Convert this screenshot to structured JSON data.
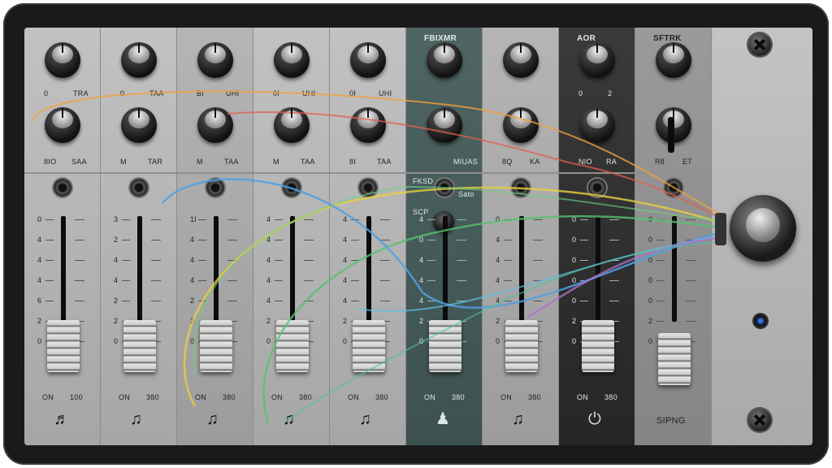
{
  "mixer": {
    "channels": [
      {
        "header": "",
        "knob1_left": "0",
        "knob1_right": "TRA",
        "knob2_left": "8IO",
        "knob2_right": "SAA",
        "scale": [
          "0",
          "4",
          "4",
          "4",
          "6",
          "2",
          "0"
        ],
        "foot_left": "ON",
        "foot_right": "100",
        "icon": "music-note-icon",
        "glyph": "♬",
        "style": "plain"
      },
      {
        "header": "",
        "knob1_left": "0",
        "knob1_right": "TAA",
        "knob2_left": "M",
        "knob2_right": "TAR",
        "scale": [
          "3",
          "2",
          "4",
          "4",
          "2",
          "2",
          "0"
        ],
        "foot_left": "ON",
        "foot_right": "380",
        "icon": "music-note-icon",
        "glyph": "♫",
        "style": "plain"
      },
      {
        "header": "",
        "knob1_left": "BI",
        "knob1_right": "UHI",
        "knob2_left": "M",
        "knob2_right": "TAA",
        "scale": [
          "1I",
          "4",
          "4",
          "4",
          "2",
          "3",
          "0"
        ],
        "foot_left": "ON",
        "foot_right": "380",
        "icon": "music-note-icon",
        "glyph": "♫",
        "style": "alt"
      },
      {
        "header": "",
        "knob1_left": "0I",
        "knob1_right": "UHI",
        "knob2_left": "M",
        "knob2_right": "TAA",
        "scale": [
          "4",
          "4",
          "4",
          "4",
          "4",
          "2",
          "0"
        ],
        "foot_left": "ON",
        "foot_right": "380",
        "icon": "music-note-icon",
        "glyph": "♫",
        "style": "plain"
      },
      {
        "header": "",
        "knob1_left": "0I",
        "knob1_right": "UHI",
        "knob2_left": "8I",
        "knob2_right": "TAA",
        "scale": [
          "4",
          "4",
          "4",
          "4",
          "4",
          "2",
          "0"
        ],
        "foot_left": "ON",
        "foot_right": "380",
        "icon": "music-note-icon",
        "glyph": "♫",
        "style": "plain"
      },
      {
        "header": "FBIXMR",
        "knob1_left": "",
        "knob1_right": "",
        "knob2_left": "",
        "knob2_right": "MIUAS",
        "section": "FKSD",
        "section2": "SCP",
        "section3": "Sato",
        "scale": [
          "4",
          "0",
          "4",
          "4",
          "4",
          "2",
          "0"
        ],
        "foot_left": "ON",
        "foot_right": "380",
        "icon": "robot-icon",
        "glyph": "♟",
        "style": "teal"
      },
      {
        "header": "",
        "knob1_left": "",
        "knob1_right": "",
        "knob2_left": "8Q",
        "knob2_right": "KA",
        "scale": [
          "0",
          "4",
          "4",
          "4",
          "4",
          "2",
          "0"
        ],
        "foot_left": "ON",
        "foot_right": "380",
        "icon": "music-note-icon",
        "glyph": "♫",
        "style": "alt"
      },
      {
        "header": "AOR",
        "knob1_left": "0",
        "knob1_right": "2",
        "knob2_left": "NIO",
        "knob2_right": "RA",
        "scale": [
          "0",
          "0",
          "0",
          "0",
          "0",
          "2",
          "0"
        ],
        "foot_left": "ON",
        "foot_right": "380",
        "icon": "power-icon",
        "glyph": "⏻",
        "style": "dark"
      },
      {
        "header": "SFTRK",
        "knob1_left": "",
        "knob1_right": "",
        "knob2_left": "R8",
        "knob2_right": "ET",
        "scale": [
          "0",
          "0",
          "0",
          "0",
          "0",
          "2",
          "0"
        ],
        "foot_left": "",
        "foot_right": "",
        "footer_label": "SIPNG",
        "icon": "",
        "glyph": "",
        "style": "mid"
      }
    ]
  }
}
